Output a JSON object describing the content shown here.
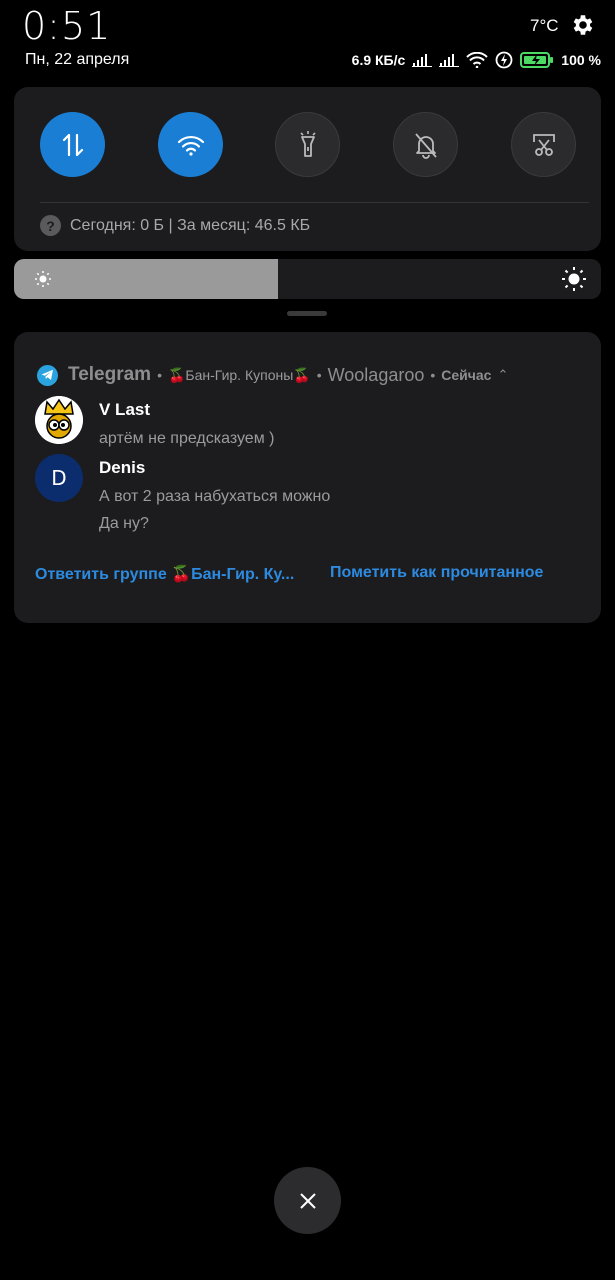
{
  "status": {
    "time": "0:51",
    "date": "Пн, 22 апреля",
    "temperature": "7°C",
    "network_speed": "6.9 КБ/с",
    "battery_percent": "100 %"
  },
  "quick_settings": {
    "toggles": [
      {
        "name": "mobile-data",
        "icon": "data-arrows-icon",
        "active": true
      },
      {
        "name": "wifi",
        "icon": "wifi-icon",
        "active": true
      },
      {
        "name": "flashlight",
        "icon": "flashlight-icon",
        "active": false
      },
      {
        "name": "silent",
        "icon": "bell-off-icon",
        "active": false
      },
      {
        "name": "screenshot",
        "icon": "scissors-icon",
        "active": false
      }
    ],
    "usage_text": "Сегодня: 0 Б | За месяц: 46.5 КБ",
    "help_glyph": "?"
  },
  "brightness": {
    "level": 0.45
  },
  "notification": {
    "app_name": "Telegram",
    "group_name": "🍒Бан-Гир. Купоны🍒",
    "account": "Woolagaroo",
    "time_label": "Сейчас",
    "messages": [
      {
        "sender": "V Last",
        "lines": [
          "артём не предсказуем )"
        ]
      },
      {
        "sender": "Denis",
        "avatar_letter": "D",
        "lines": [
          "А вот 2 раза набухаться можно",
          "Да ну?"
        ]
      }
    ],
    "actions": {
      "reply": "Ответить группе 🍒Бан-Гир. Ку...",
      "mark_read": "Пометить как прочитанное"
    }
  },
  "colors": {
    "accent": "#1a7fd4",
    "panel": "#1c1c1e",
    "link": "#2c8be0",
    "telegram": "#2aa3df",
    "avatar_denis": "#0b2d6e"
  }
}
